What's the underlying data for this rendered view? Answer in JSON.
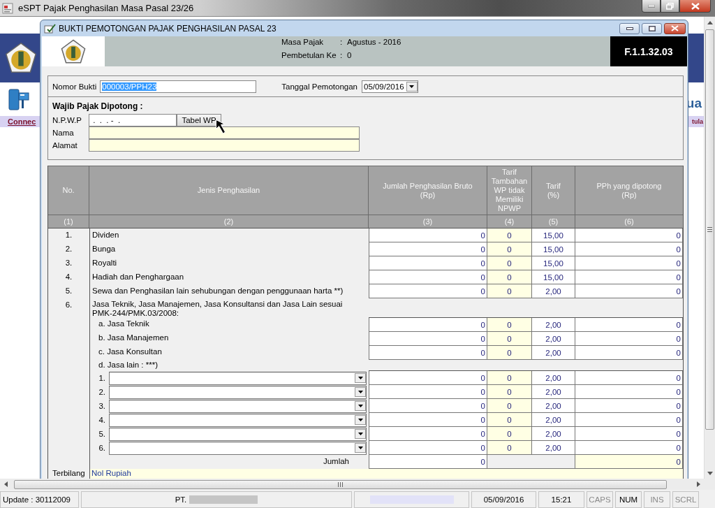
{
  "app_window": {
    "title": "eSPT Pajak Penghasilan Masa Pasal 23/26"
  },
  "background": {
    "link": "Connec",
    "heading_fragment": "ua",
    "link_fragment": "tula"
  },
  "dialog": {
    "title": "BUKTI PEMOTONGAN PAJAK PENGHASILAN PASAL 23",
    "header": [
      {
        "label": "Masa Pajak",
        "separator": ":",
        "value": "Agustus - 2016"
      },
      {
        "label": "Pembetulan Ke",
        "separator": ":",
        "value": "0"
      }
    ],
    "form_code": "F.1.1.32.03"
  },
  "form": {
    "nomor_bukti": {
      "label": "Nomor Bukti",
      "value": "000003/PPH23",
      "highlighted": true
    },
    "tanggal": {
      "label": "Tanggal Pemotongan",
      "value": "05/09/2016"
    },
    "section_title": "Wajib Pajak Dipotong :",
    "npwp": {
      "label": "N.P.W.P",
      "value": " .  .  . -  ."
    },
    "button": "Tabel WP",
    "nama": {
      "label": "Nama"
    },
    "alamat": {
      "label": "Alamat"
    }
  },
  "table": {
    "columns": [
      {
        "label": "No.",
        "number": "(1)"
      },
      {
        "label": "Jenis Penghasilan",
        "number": "(2)"
      },
      {
        "label": "Jumlah Penghasilan Bruto\n(Rp)",
        "number": "(3)"
      },
      {
        "label": "Tarif\nTambahan\nWP tidak\nMemiliki\nNPWP",
        "number": "(4)"
      },
      {
        "label": "Tarif\n(%)",
        "number": "(5)"
      },
      {
        "label": "PPh yang dipotong\n(Rp)",
        "number": "(6)"
      }
    ],
    "rows": [
      {
        "kind": "item",
        "no": "1.",
        "label": "Dividen",
        "bruto": "0",
        "tambahan": "0",
        "tarif": "15,00",
        "pph": "0"
      },
      {
        "kind": "item",
        "no": "2.",
        "label": "Bunga",
        "bruto": "0",
        "tambahan": "0",
        "tarif": "15,00",
        "pph": "0"
      },
      {
        "kind": "item",
        "no": "3.",
        "label": "Royalti",
        "bruto": "0",
        "tambahan": "0",
        "tarif": "15,00",
        "pph": "0"
      },
      {
        "kind": "item",
        "no": "4.",
        "label": "Hadiah dan Penghargaan",
        "bruto": "0",
        "tambahan": "0",
        "tarif": "15,00",
        "pph": "0"
      },
      {
        "kind": "item",
        "no": "5.",
        "label": "Sewa dan Penghasilan lain sehubungan dengan penggunaan harta **)",
        "bruto": "0",
        "tambahan": "0",
        "tarif": "2,00",
        "pph": "0"
      },
      {
        "kind": "group",
        "no": "6.",
        "label": "Jasa Teknik, Jasa Manajemen,  Jasa Konsultansi dan Jasa Lain sesuai PMK-244/PMK.03/2008:"
      },
      {
        "kind": "sub",
        "label": "a. Jasa Teknik",
        "bruto": "0",
        "tambahan": "0",
        "tarif": "2,00",
        "pph": "0"
      },
      {
        "kind": "sub",
        "label": "b. Jasa Manajemen",
        "bruto": "0",
        "tambahan": "0",
        "tarif": "2,00",
        "pph": "0"
      },
      {
        "kind": "sub",
        "label": "c. Jasa Konsultan",
        "bruto": "0",
        "tambahan": "0",
        "tarif": "2,00",
        "pph": "0"
      },
      {
        "kind": "note",
        "label": "d. Jasa lain : ***)"
      },
      {
        "kind": "other",
        "no": "1.",
        "bruto": "0",
        "tambahan": "0",
        "tarif": "2,00",
        "pph": "0"
      },
      {
        "kind": "other",
        "no": "2.",
        "bruto": "0",
        "tambahan": "0",
        "tarif": "2,00",
        "pph": "0"
      },
      {
        "kind": "other",
        "no": "3.",
        "bruto": "0",
        "tambahan": "0",
        "tarif": "2,00",
        "pph": "0"
      },
      {
        "kind": "other",
        "no": "4.",
        "bruto": "0",
        "tambahan": "0",
        "tarif": "2,00",
        "pph": "0"
      },
      {
        "kind": "other",
        "no": "5.",
        "bruto": "0",
        "tambahan": "0",
        "tarif": "2,00",
        "pph": "0"
      },
      {
        "kind": "other",
        "no": "6.",
        "bruto": "0",
        "tambahan": "0",
        "tarif": "2,00",
        "pph": "0"
      },
      {
        "kind": "total",
        "label": "Jumlah",
        "bruto": "0",
        "pph": "0"
      },
      {
        "kind": "terbilang",
        "no": "Terbilang",
        "value": "Nol Rupiah"
      }
    ]
  },
  "status_bar": {
    "update": "Update : 30112009",
    "company": "PT.",
    "date": "05/09/2016",
    "time": "15:21",
    "keys": [
      {
        "label": "CAPS",
        "on": false
      },
      {
        "label": "NUM",
        "on": true
      },
      {
        "label": "INS",
        "on": false
      },
      {
        "label": "SCRL",
        "on": false
      }
    ]
  }
}
